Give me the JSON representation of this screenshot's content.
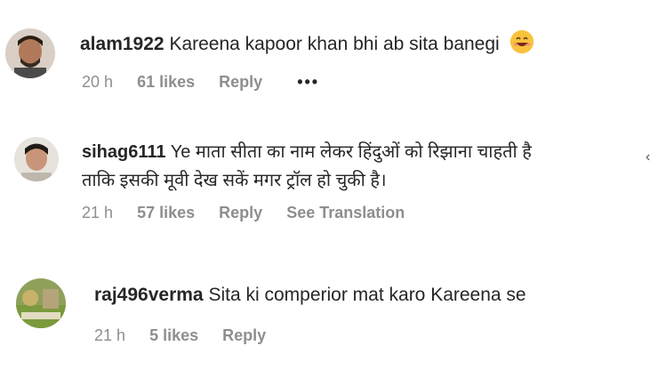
{
  "comments": [
    {
      "username": "alam1922",
      "text": "Kareena kapoor khan bhi ab sita banegi",
      "emoji": "grinning-face-emoji",
      "time": "20 h",
      "likes": "61 likes",
      "reply": "Reply",
      "more": "•••"
    },
    {
      "username": "sihag6111",
      "text_line1": "Ye माता सीता का नाम लेकर हिंदुओं को रिझाना चाहती है",
      "text_line2": "ताकि इसकी मूवी देख सकें मगर ट्रॉल हो चुकी है।",
      "time": "21 h",
      "likes": "57 likes",
      "reply": "Reply",
      "translate": "See Translation"
    },
    {
      "username": "raj496verma",
      "text": "Sita ki comperior mat karo Kareena se",
      "time": "21 h",
      "likes": "5 likes",
      "reply": "Reply"
    }
  ],
  "icons": {
    "side_arrow": "chevron-left-icon"
  },
  "colors": {
    "text": "#262626",
    "meta": "#8e8e8e",
    "emoji": "#f9c23c"
  }
}
